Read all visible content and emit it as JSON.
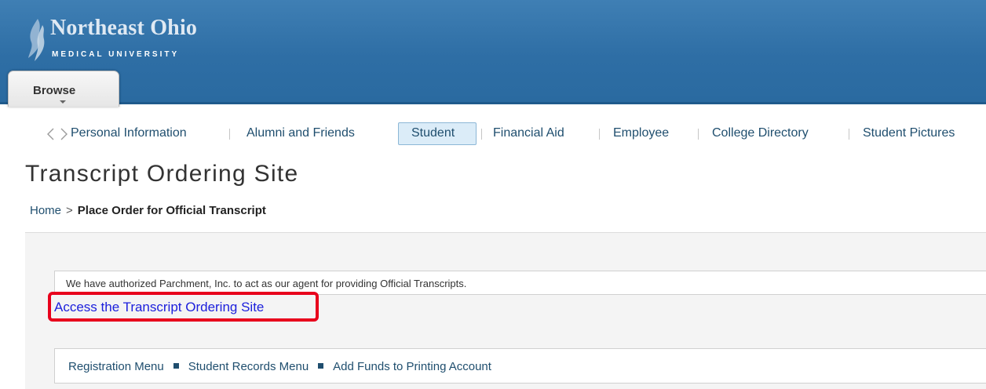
{
  "header": {
    "logo_name": "Northeast Ohio",
    "logo_subtitle": "MEDICAL UNIVERSITY",
    "browse_label": "Browse",
    "colors": {
      "banner": "#2e6ea5",
      "accent_text": "#dfe9f3"
    }
  },
  "nav": {
    "items": [
      {
        "label": "Personal Information",
        "active": false
      },
      {
        "label": "Alumni and Friends",
        "active": false
      },
      {
        "label": "Student",
        "active": true
      },
      {
        "label": "Financial Aid",
        "active": false
      },
      {
        "label": "Employee",
        "active": false
      },
      {
        "label": "College Directory",
        "active": false
      },
      {
        "label": "Student Pictures",
        "active": false
      }
    ]
  },
  "page": {
    "title": "Transcript Ordering Site",
    "breadcrumb": {
      "home": "Home",
      "separator": ">",
      "current": "Place Order for Official Transcript"
    }
  },
  "content": {
    "info_text": "We have authorized Parchment, Inc. to act as our agent for providing Official Transcripts.",
    "access_link": "Access the Transcript Ordering Site",
    "highlight_color": "#e8001c",
    "footer_menu": [
      {
        "label": "Registration Menu"
      },
      {
        "label": "Student Records Menu"
      },
      {
        "label": "Add Funds to Printing Account"
      }
    ]
  }
}
